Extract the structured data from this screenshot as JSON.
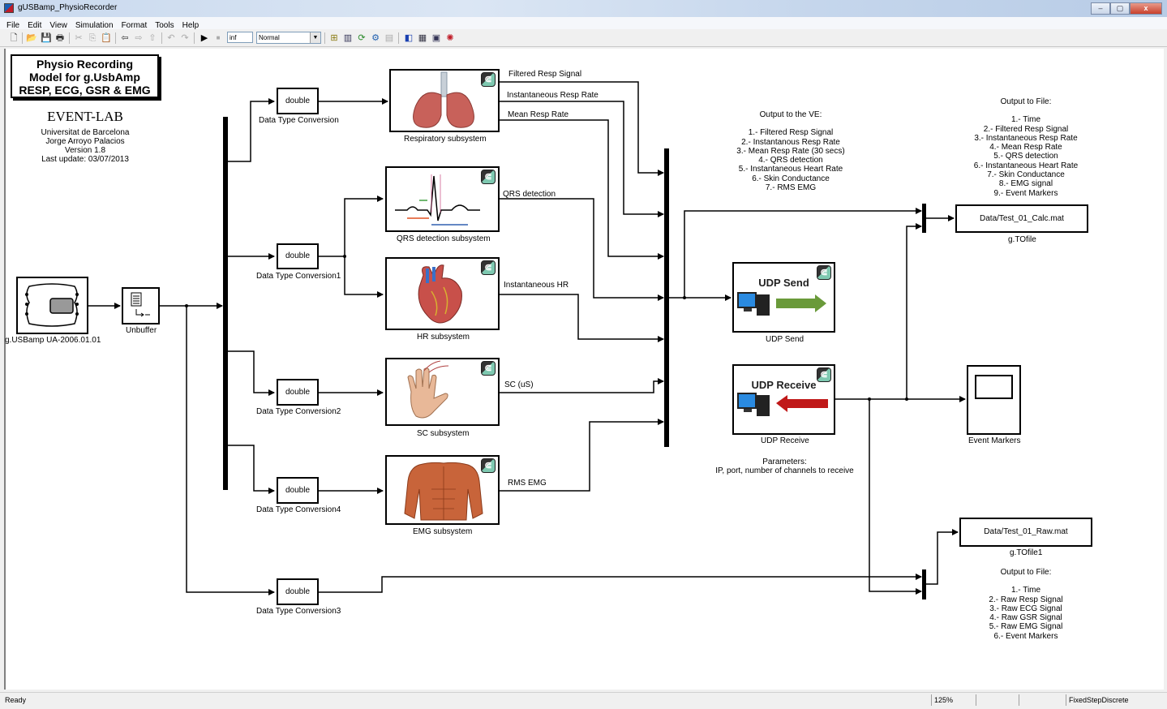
{
  "window": {
    "title": "gUSBamp_PhysioRecorder",
    "controls": {
      "minimize": "–",
      "maximize": "▢",
      "close": "x"
    }
  },
  "menubar": {
    "items": [
      "File",
      "Edit",
      "View",
      "Simulation",
      "Format",
      "Tools",
      "Help"
    ]
  },
  "toolbar": {
    "icons": {
      "new": "🗋",
      "open": "📂",
      "save": "💾",
      "print": "🖶",
      "cut": "✂",
      "copy": "⎘",
      "paste": "📋",
      "back": "⇦",
      "forward": "⇨",
      "up": "⇧",
      "undo": "↶",
      "redo": "↷",
      "start": "▶",
      "stop": "■",
      "build": "⊞",
      "library": "▥",
      "update": "⟳",
      "debug": "⚙",
      "disabled": "▤",
      "model_explorer": "◧",
      "browser": "▦",
      "config": "▣",
      "profiler": "✺"
    },
    "stop_time": "inf",
    "sim_mode": "Normal",
    "dropdown_arrow": "▼"
  },
  "header": {
    "title_lines": [
      "Physio Recording",
      "Model for g.UsbAmp",
      "RESP, ECG, GSR & EMG"
    ],
    "lab": "EVENT-LAB",
    "info_lines": [
      "Universitat de Barcelona",
      "Jorge Arroyo Palacios",
      "Version 1.8",
      "Last update: 03/07/2013"
    ]
  },
  "blocks": {
    "device": {
      "label": "g.USBamp UA-2006.01.01"
    },
    "unbuffer": {
      "label": "Unbuffer"
    },
    "conv0": {
      "text": "double",
      "label": "Data Type Conversion"
    },
    "conv1": {
      "text": "double",
      "label": "Data Type Conversion1"
    },
    "conv2": {
      "text": "double",
      "label": "Data Type Conversion2"
    },
    "conv4": {
      "text": "double",
      "label": "Data Type Conversion4"
    },
    "conv3": {
      "text": "double",
      "label": "Data Type Conversion3"
    },
    "resp": {
      "label": "Respiratory subsystem",
      "outputs": [
        "Filtered Resp Signal",
        "Instantaneous Resp Rate",
        "Mean Resp Rate"
      ]
    },
    "qrs": {
      "label": "QRS detection subsystem",
      "outputs": [
        "QRS detection"
      ]
    },
    "hr": {
      "label": "HR subsystem",
      "outputs": [
        "Instantaneous HR"
      ]
    },
    "sc": {
      "label": "SC subsystem",
      "outputs": [
        "SC (uS)"
      ]
    },
    "emg": {
      "label": "EMG subsystem",
      "outputs": [
        "RMS EMG"
      ]
    },
    "udp_send": {
      "title": "UDP Send",
      "label": "UDP Send"
    },
    "udp_receive": {
      "title": "UDP Receive",
      "label": "UDP Receive"
    },
    "tofile_calc": {
      "text": "Data/Test_01_Calc.mat",
      "label": "g.TOfile"
    },
    "tofile_raw": {
      "text": "Data/Test_01_Raw.mat",
      "label": "g.TOfile1"
    },
    "scope": {
      "label": "Event Markers"
    }
  },
  "annotations": {
    "ve_output": {
      "title": "Output to the VE:",
      "items": [
        "1.- Filtered Resp Signal",
        "2.- Instantanous Resp Rate",
        "3.- Mean Resp Rate (30 secs)",
        "4.- QRS detection",
        "5.- Instantaneous Heart Rate",
        "6.- Skin Conductance",
        "7.- RMS EMG"
      ]
    },
    "calc_file": {
      "title": "Output to File:",
      "items": [
        "1.- Time",
        "2.- Filtered Resp Signal",
        "3.- Instantaneous Resp Rate",
        "4.- Mean Resp Rate",
        "5.- QRS detection",
        "6.- Instantaneous Heart Rate",
        "7.- Skin Conductance",
        "8.- EMG signal",
        "9.- Event Markers"
      ]
    },
    "udp_params": {
      "lines": [
        "Parameters:",
        "IP, port, number of channels to receive"
      ]
    },
    "raw_file": {
      "title": "Output to File:",
      "items": [
        "1.- Time",
        "2.- Raw Resp Signal",
        "3.- Raw ECG Signal",
        "4.- Raw GSR Signal",
        "5.- Raw EMG Signal",
        "6.- Event Markers"
      ]
    }
  },
  "statusbar": {
    "status": "Ready",
    "zoom": "125%",
    "cell2": "",
    "cell3": "",
    "solver": "FixedStepDiscrete"
  }
}
